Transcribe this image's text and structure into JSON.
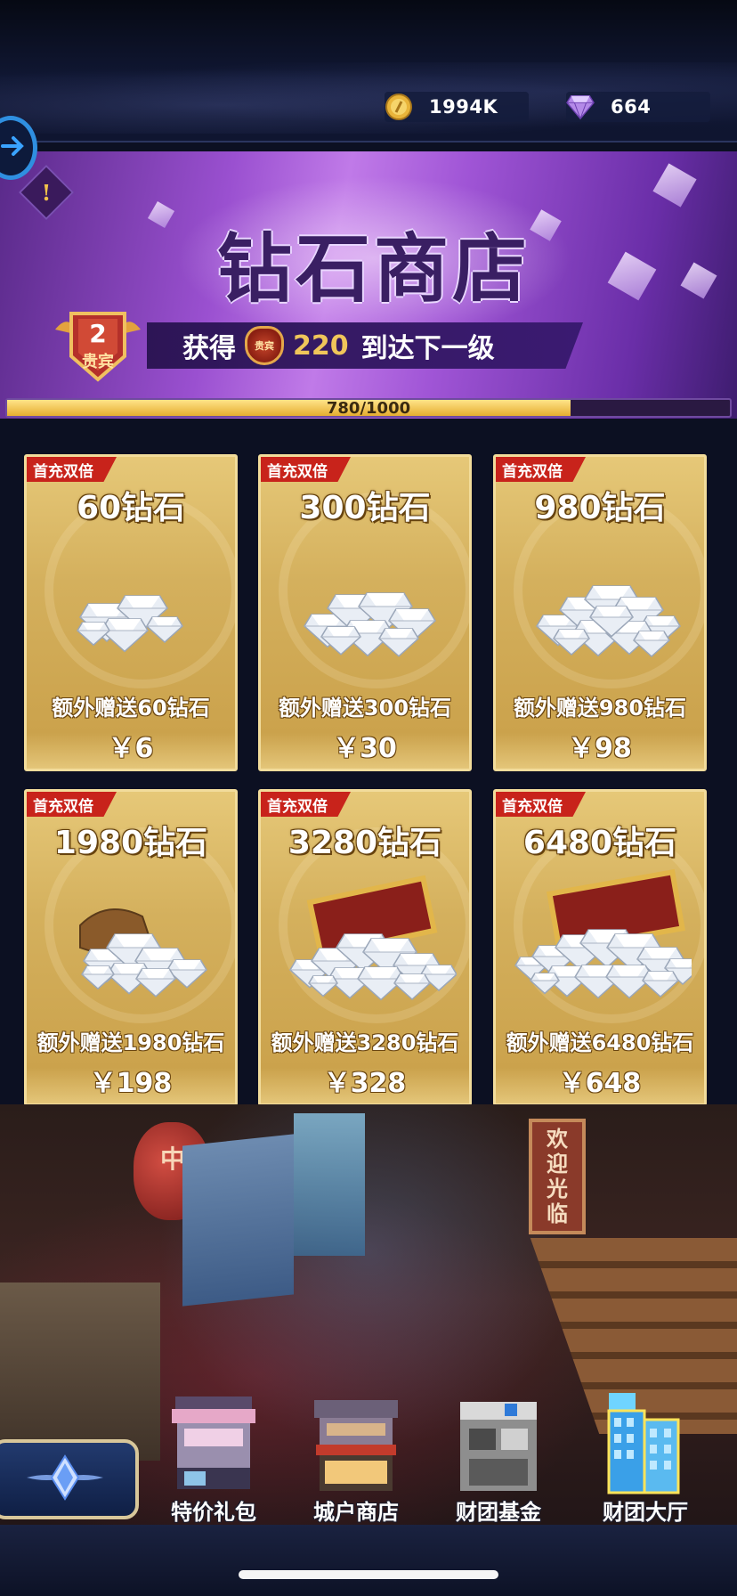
{
  "topbar": {
    "coins": "1994K",
    "gems": "664",
    "coin_icon": "gold-coin-icon",
    "gem_icon": "purple-diamond-icon"
  },
  "banner": {
    "title": "钻石商店",
    "vip_level": "2",
    "vip_label": "贵宾",
    "vip_mini_label": "贵宾",
    "progress_text_prefix": "获得",
    "progress_points": "220",
    "progress_text_suffix": "到达下一级",
    "progress_label": "780/1000",
    "progress_fraction": 0.78
  },
  "items": [
    {
      "tag": "首充双倍",
      "name": "60钻石",
      "bonus": "额外赠送60钻石",
      "price": "￥6",
      "art": "small-diamond-pile"
    },
    {
      "tag": "首充双倍",
      "name": "300钻石",
      "bonus": "额外赠送300钻石",
      "price": "￥30",
      "art": "medium-diamond-pile"
    },
    {
      "tag": "首充双倍",
      "name": "980钻石",
      "bonus": "额外赠送980钻石",
      "price": "￥98",
      "art": "large-diamond-pile"
    },
    {
      "tag": "首充双倍",
      "name": "1980钻石",
      "bonus": "额外赠送1980钻石",
      "price": "￥198",
      "art": "diamond-sack"
    },
    {
      "tag": "首充双倍",
      "name": "3280钻石",
      "bonus": "额外赠送3280钻石",
      "price": "￥328",
      "art": "treasure-chest"
    },
    {
      "tag": "首充双倍",
      "name": "6480钻石",
      "bonus": "额外赠送6480钻石",
      "price": "￥648",
      "art": "big-treasure-chest"
    }
  ],
  "street": {
    "lantern_text": "中",
    "sign_text": [
      "欢",
      "迎",
      "光",
      "临"
    ]
  },
  "nav": [
    {
      "label": "特价礼包",
      "icon": "gift-shop-icon",
      "active": false
    },
    {
      "label": "城户商店",
      "icon": "store-icon",
      "active": false
    },
    {
      "label": "财团基金",
      "icon": "fund-building-icon",
      "active": false
    },
    {
      "label": "财团大厅",
      "icon": "hall-building-icon",
      "active": true
    }
  ],
  "colors": {
    "tag_red": "#c8231b",
    "card_gold": "#d4b05d",
    "banner_purple": "#9a50d0",
    "progress_gold": "#e5ad2f"
  }
}
